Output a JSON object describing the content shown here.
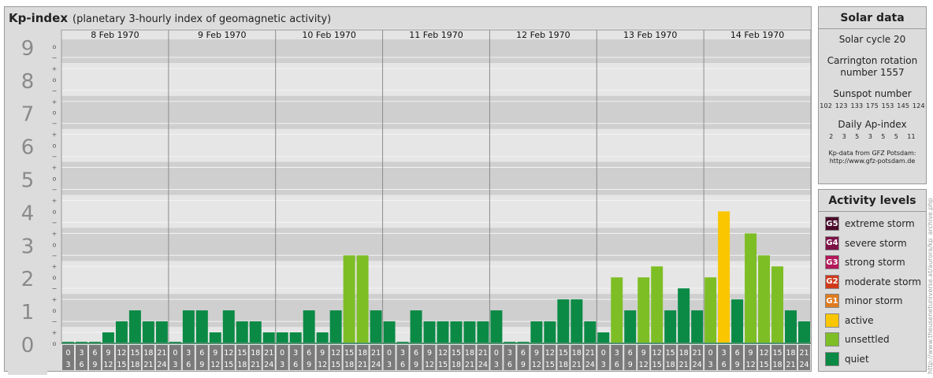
{
  "title": "Kp-index",
  "subtitle": "(planetary 3-hourly index of geomagnetic activity)",
  "chart_data": {
    "type": "bar",
    "y_axis_labels": [
      "0",
      "1",
      "2",
      "3",
      "4",
      "5",
      "6",
      "7",
      "8",
      "9"
    ],
    "minor_labels": [
      "o",
      "−",
      "+"
    ],
    "ylim": [
      0,
      9
    ],
    "days": [
      {
        "label": "8 Feb 1970",
        "values": [
          0.0,
          0.0,
          0.0,
          0.333,
          0.667,
          1.0,
          0.667,
          0.667
        ]
      },
      {
        "label": "9 Feb 1970",
        "values": [
          0.0,
          1.0,
          1.0,
          0.333,
          1.0,
          0.667,
          0.667,
          0.333
        ]
      },
      {
        "label": "10 Feb 1970",
        "values": [
          0.333,
          0.333,
          1.0,
          0.333,
          1.0,
          2.667,
          2.667,
          1.0
        ]
      },
      {
        "label": "11 Feb 1970",
        "values": [
          0.667,
          0.0,
          1.0,
          0.667,
          0.667,
          0.667,
          0.667,
          0.667
        ]
      },
      {
        "label": "12 Feb 1970",
        "values": [
          1.0,
          0.0,
          0.0,
          0.667,
          0.667,
          1.333,
          1.333,
          0.667
        ]
      },
      {
        "label": "13 Feb 1970",
        "values": [
          0.333,
          2.0,
          1.0,
          2.0,
          2.333,
          1.0,
          1.667,
          1.0
        ]
      },
      {
        "label": "14 Feb 1970",
        "values": [
          2.0,
          4.0,
          1.333,
          3.333,
          2.667,
          2.333,
          1.0,
          0.667
        ]
      }
    ],
    "hour_ticks": [
      [
        "0",
        "3"
      ],
      [
        "3",
        "6"
      ],
      [
        "6",
        "9"
      ],
      [
        "9",
        "12"
      ],
      [
        "12",
        "15"
      ],
      [
        "15",
        "18"
      ],
      [
        "18",
        "21"
      ],
      [
        "21",
        "24"
      ]
    ],
    "colors": {
      "quiet": "#0b8a45",
      "unsettled": "#7dbe25",
      "active": "#f9c600",
      "minor_storm": "#e07b1f",
      "moderate_storm": "#d03a1b",
      "strong_storm": "#b3195a",
      "severe_storm": "#7d1247",
      "extreme_storm": "#4b0a2a"
    }
  },
  "solar": {
    "heading": "Solar data",
    "cycle": "Solar cycle 20",
    "carrington_1": "Carrington rotation",
    "carrington_2": "number 1557",
    "sunspot_label": "Sunspot number",
    "sunspot_values": "102 123 133 175 153 145 124",
    "ap_label": "Daily Ap-index",
    "ap_values": "2   3   5   3   5   5   11",
    "source_1": "Kp-data from GFZ Potsdam:",
    "source_2": "http://www.gfz-potsdam.de"
  },
  "activity": {
    "heading": "Activity levels",
    "levels": [
      {
        "badge": "G5",
        "label": "extreme storm",
        "color": "#4b0a2a"
      },
      {
        "badge": "G4",
        "label": "severe storm",
        "color": "#7d1247"
      },
      {
        "badge": "G3",
        "label": "strong storm",
        "color": "#b3195a"
      },
      {
        "badge": "G2",
        "label": "moderate storm",
        "color": "#d03a1b"
      },
      {
        "badge": "G1",
        "label": "minor storm",
        "color": "#e07b1f"
      },
      {
        "badge": "",
        "label": "active",
        "color": "#f9c600"
      },
      {
        "badge": "",
        "label": "unsettled",
        "color": "#7dbe25"
      },
      {
        "badge": "",
        "label": "quiet",
        "color": "#0b8a45"
      }
    ]
  },
  "credit": "http://www.theusenetuniverse.at/aurora/kp_archive.php"
}
